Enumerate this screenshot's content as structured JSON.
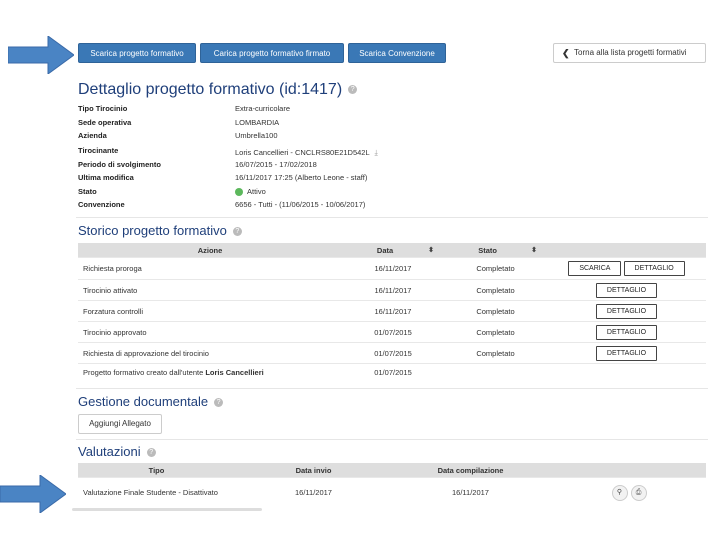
{
  "toolbar": {
    "btn_download": "Scarica progetto formativo",
    "btn_upload": "Carica progetto formativo firmato",
    "btn_convention": "Scarica Convenzione",
    "btn_back": "Torna alla lista progetti formativi"
  },
  "colors": {
    "accent": "#3a78b6",
    "arrow": "#4a84c4",
    "title": "#1f3f7a",
    "status_green": "#5cb85c"
  },
  "title": "Dettaglio progetto formativo (id:1417)",
  "details": [
    {
      "k": "Tipo Tirocinio",
      "v": "Extra-curricolare"
    },
    {
      "k": "Sede operativa",
      "v": "LOMBARDIA"
    },
    {
      "k": "Azienda",
      "v": "Umbrella100"
    },
    {
      "k": "Tirocinante",
      "v": "Loris Cancellieri - CNCLRS80E21D542L"
    },
    {
      "k": "Periodo di svolgimento",
      "v": "16/07/2015 - 17/02/2018"
    },
    {
      "k": "Ultima modifica",
      "v": "16/11/2017 17:25 (Alberto Leone - staff)"
    },
    {
      "k": "Stato",
      "v": "Attivo"
    },
    {
      "k": "Convenzione",
      "v": "6656 - Tutti - (11/06/2015 - 10/06/2017)"
    }
  ],
  "storico": {
    "title": "Storico progetto formativo",
    "headers": [
      "Azione",
      "Data",
      "Stato"
    ],
    "rows": [
      {
        "azione": "Richiesta proroga",
        "data": "16/11/2017",
        "stato": "Completato",
        "btn1": "SCARICA",
        "btn2": "DETTAGLIO"
      },
      {
        "azione": "Tirocinio attivato",
        "data": "16/11/2017",
        "stato": "Completato",
        "btn1": "DETTAGLIO"
      },
      {
        "azione": "Forzatura controlli",
        "data": "16/11/2017",
        "stato": "Completato",
        "btn1": "DETTAGLIO"
      },
      {
        "azione": "Tirocinio approvato",
        "data": "01/07/2015",
        "stato": "Completato",
        "btn1": "DETTAGLIO"
      },
      {
        "azione": "Richiesta di approvazione del tirocinio",
        "data": "01/07/2015",
        "stato": "Completato",
        "btn1": "DETTAGLIO"
      }
    ],
    "last_row": {
      "prefix": "Progetto formativo creato dall'utente ",
      "user": "Loris Cancellieri",
      "data": "01/07/2015"
    }
  },
  "gestione": {
    "title": "Gestione documentale",
    "btn_add": "Aggiungi Allegato"
  },
  "valutazioni": {
    "title": "Valutazioni",
    "headers": [
      "Tipo",
      "Data invio",
      "Data compilazione"
    ],
    "rows": [
      {
        "tipo": "Valutazione Finale Studente - Disattivato",
        "invio": "16/11/2017",
        "compilazione": "16/11/2017"
      }
    ]
  }
}
